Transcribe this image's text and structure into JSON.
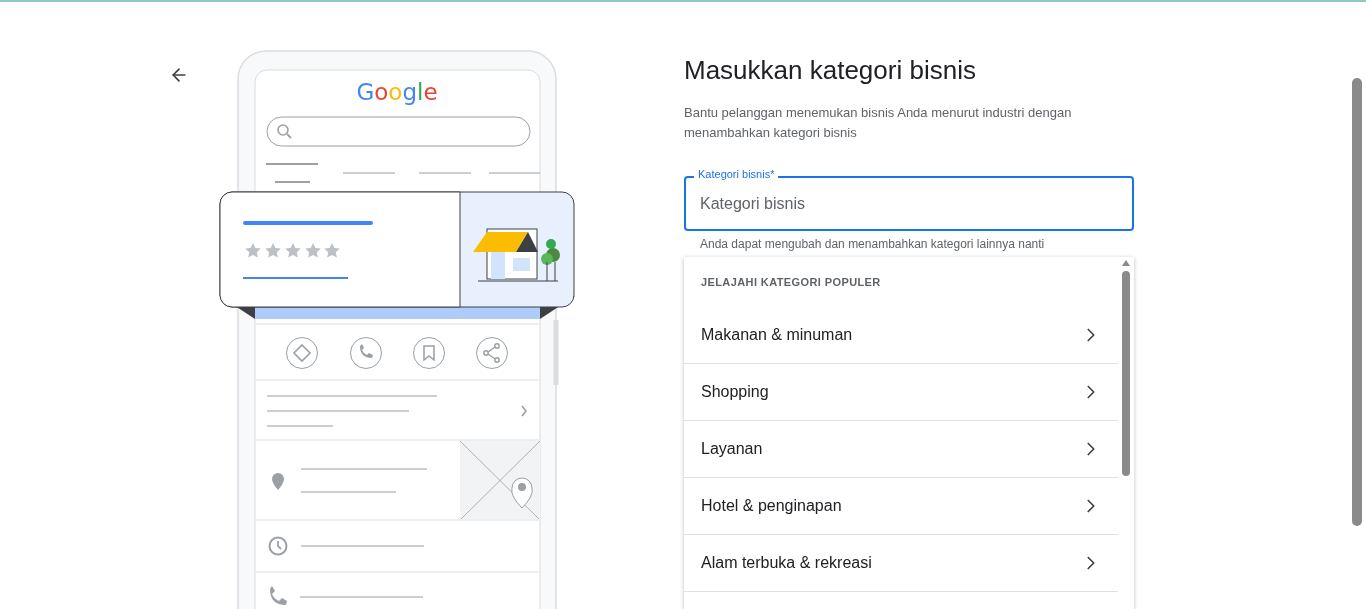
{
  "illustration": {
    "logo": "Google"
  },
  "heading": "Masukkan kategori bisnis",
  "description": "Bantu pelanggan menemukan bisnis Anda menurut industri dengan menambahkan kategori bisnis",
  "category_field": {
    "label": "Kategori bisnis*",
    "placeholder": "Kategori bisnis",
    "focused": true
  },
  "helper_text": "Anda dapat mengubah dan menambahkan kategori lainnya nanti",
  "suggestions": {
    "heading": "JELAJAHI KATEGORI POPULER",
    "items": [
      {
        "label": "Makanan & minuman"
      },
      {
        "label": "Shopping"
      },
      {
        "label": "Layanan"
      },
      {
        "label": "Hotel & penginapan"
      },
      {
        "label": "Alam terbuka & rekreasi"
      }
    ]
  }
}
